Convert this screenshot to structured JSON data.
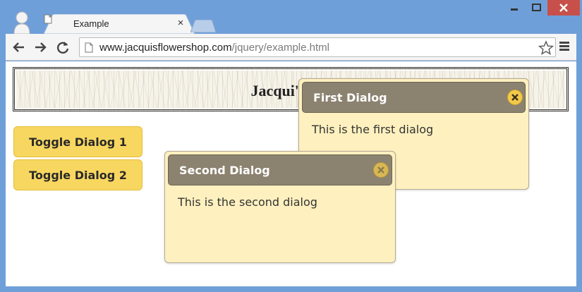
{
  "browser": {
    "tab_title": "Example",
    "tab_close": "×",
    "url_host": "www.jacquisflowershop.com",
    "url_path": "/jquery/example.html"
  },
  "page": {
    "banner_title": "Jacqui's Flo",
    "buttons": {
      "toggle1": "Toggle Dialog 1",
      "toggle2": "Toggle Dialog 2"
    },
    "dialogs": [
      {
        "title": "First Dialog",
        "body": "This is the first dialog"
      },
      {
        "title": "Second Dialog",
        "body": "This is the second dialog"
      }
    ]
  },
  "colors": {
    "window_frame": "#6f9fd9",
    "button_fill": "#f8d760",
    "dialog_fill": "#fff1bf",
    "dialog_titlebar": "#8c8270",
    "close_button": "#c7504a"
  },
  "icons": {
    "tab": "page-icon",
    "nav": [
      "back-arrow-icon",
      "forward-arrow-icon",
      "reload-icon"
    ],
    "omnibox": [
      "page-icon",
      "star-icon"
    ],
    "menu": "hamburger-menu-icon",
    "dialog_close": "x-circle-icon"
  }
}
